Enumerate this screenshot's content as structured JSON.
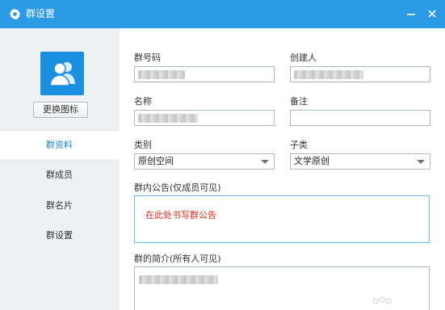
{
  "window": {
    "title": "群设置",
    "title_icon": "gear-icon",
    "minimize_glyph": "—",
    "close_glyph": "✕",
    "accent_color": "#2a9ae6"
  },
  "sidebar": {
    "avatar_icon": "group-users-icon",
    "change_icon_label": "更换图标",
    "items": [
      {
        "label": "群资料",
        "active": true
      },
      {
        "label": "群成员",
        "active": false
      },
      {
        "label": "群名片",
        "active": false
      },
      {
        "label": "群设置",
        "active": false
      }
    ]
  },
  "form": {
    "group_number_label": "群号码",
    "creator_label": "创建人",
    "name_label": "名称",
    "remark_label": "备注",
    "category_label": "类别",
    "category_value": "原创空间",
    "subcategory_label": "子类",
    "subcategory_value": "文学原创",
    "announcement_label": "群内公告(仅成员可见)",
    "announcement_placeholder": "在此处书写群公告",
    "intro_label": "群的简介(所有人可见)"
  }
}
